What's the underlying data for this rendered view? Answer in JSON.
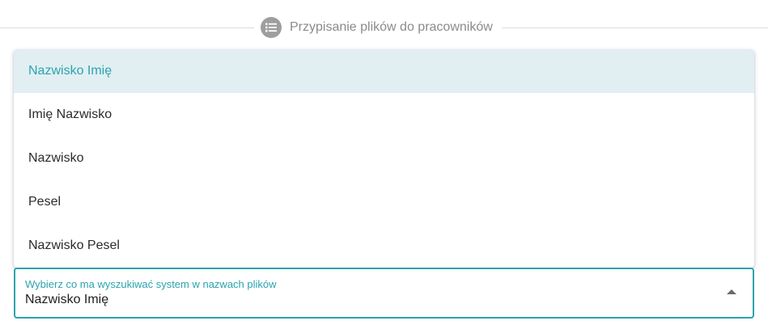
{
  "section": {
    "title": "Przypisanie plików do pracowników",
    "icon": "list-icon"
  },
  "dropdown": {
    "options": [
      "Nazwisko Imię",
      "Imię Nazwisko",
      "Nazwisko",
      "Pesel",
      "Nazwisko Pesel"
    ],
    "selected_index": 0
  },
  "select_field": {
    "label": "Wybierz co ma wyszukiwać system w nazwach plików",
    "value": "Nazwisko Imię"
  },
  "colors": {
    "accent": "#2ba3ad",
    "selected_background": "#e1eff3",
    "icon_background": "#9e9e9e"
  }
}
